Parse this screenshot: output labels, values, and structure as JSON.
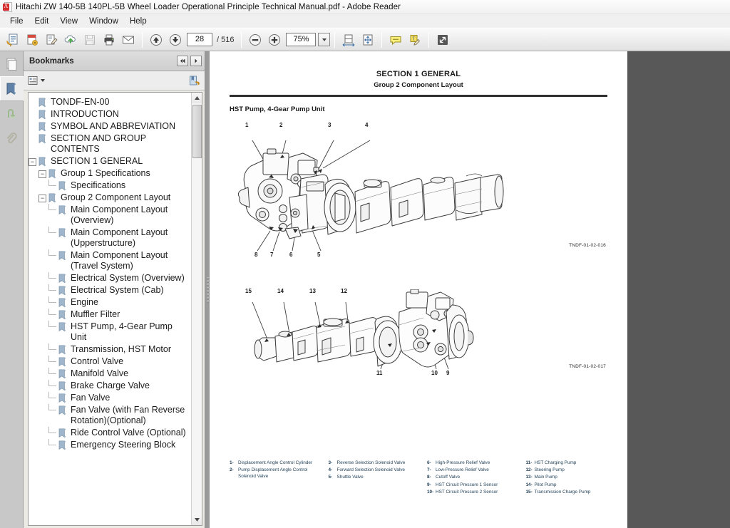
{
  "window": {
    "title": "Hitachi ZW 140-5B 140PL-5B Wheel Loader Operational Principle Technical Manual.pdf - Adobe Reader",
    "app_icon": "pdf-document-icon"
  },
  "menu": {
    "items": [
      "File",
      "Edit",
      "View",
      "Window",
      "Help"
    ]
  },
  "toolbar": {
    "buttons": [
      {
        "name": "open-file-icon",
        "label": "Open"
      },
      {
        "name": "create-pdf-icon",
        "label": "Create PDF"
      },
      {
        "name": "edit-pdf-icon",
        "label": "Edit PDF"
      },
      {
        "name": "cloud-upload-icon",
        "label": "Save to Cloud"
      },
      {
        "name": "save-disk-icon",
        "label": "Save"
      },
      {
        "name": "print-icon",
        "label": "Print"
      },
      {
        "name": "email-icon",
        "label": "Email"
      }
    ],
    "page_up_icon": "arrow-up-circle-icon",
    "page_down_icon": "arrow-down-circle-icon",
    "current_page": "28",
    "page_total": "/ 516",
    "zoom_out_icon": "minus-circle-icon",
    "zoom_in_icon": "plus-circle-icon",
    "zoom_value": "75%",
    "zoom_dropdown_icon": "chevron-down-icon",
    "fit_width_icon": "fit-width-icon",
    "fit_page_icon": "fit-page-icon",
    "comment_icon": "sticky-note-icon",
    "highlight_icon": "highlight-text-icon",
    "fullscreen_icon": "fullscreen-icon"
  },
  "rail": {
    "items": [
      {
        "name": "page-thumbnails-icon",
        "label": "Page Thumbnails",
        "selected": false
      },
      {
        "name": "bookmarks-icon",
        "label": "Bookmarks",
        "selected": true
      },
      {
        "name": "signatures-icon",
        "label": "Signatures",
        "selected": false
      },
      {
        "name": "attachments-icon",
        "label": "Attachments",
        "selected": false
      }
    ]
  },
  "bookmarks_panel": {
    "title": "Bookmarks",
    "prev_icon": "nav-prev-icon",
    "next_icon": "nav-next-icon",
    "options_icon": "bookmark-options-icon",
    "options_caret_icon": "caret-down-icon",
    "new_bookmark_icon": "new-bookmark-icon",
    "scroll_up_icon": "scroll-up-arrow",
    "scroll_down_icon": "scroll-down-arrow",
    "items": [
      {
        "label": "TONDF-EN-00",
        "indent": 0,
        "expander": ""
      },
      {
        "label": "INTRODUCTION",
        "indent": 0,
        "expander": ""
      },
      {
        "label": "SYMBOL AND ABBREVIATION",
        "indent": 0,
        "expander": ""
      },
      {
        "label": "SECTION AND GROUP CONTENTS",
        "indent": 0,
        "expander": ""
      },
      {
        "label": "SECTION 1 GENERAL",
        "indent": 0,
        "expander": "−"
      },
      {
        "label": "Group 1 Specifications",
        "indent": 1,
        "expander": "−"
      },
      {
        "label": "Specifications",
        "indent": 2,
        "expander": ""
      },
      {
        "label": "Group 2 Component Layout",
        "indent": 1,
        "expander": "−"
      },
      {
        "label": "Main Component Layout (Overview)",
        "indent": 2,
        "expander": ""
      },
      {
        "label": "Main Component Layout (Upperstructure)",
        "indent": 2,
        "expander": ""
      },
      {
        "label": "Main Component Layout (Travel System)",
        "indent": 2,
        "expander": ""
      },
      {
        "label": "Electrical System (Overview)",
        "indent": 2,
        "expander": ""
      },
      {
        "label": "Electrical System (Cab)",
        "indent": 2,
        "expander": ""
      },
      {
        "label": "Engine",
        "indent": 2,
        "expander": ""
      },
      {
        "label": "Muffler Filter",
        "indent": 2,
        "expander": ""
      },
      {
        "label": "HST Pump, 4-Gear Pump Unit",
        "indent": 2,
        "expander": ""
      },
      {
        "label": "Transmission, HST Motor",
        "indent": 2,
        "expander": ""
      },
      {
        "label": "Control Valve",
        "indent": 2,
        "expander": ""
      },
      {
        "label": "Manifold Valve",
        "indent": 2,
        "expander": ""
      },
      {
        "label": "Brake Charge Valve",
        "indent": 2,
        "expander": ""
      },
      {
        "label": "Fan Valve",
        "indent": 2,
        "expander": ""
      },
      {
        "label": "Fan Valve (with Fan Reverse Rotation)(Optional)",
        "indent": 2,
        "expander": ""
      },
      {
        "label": "Ride Control Valve (Optional)",
        "indent": 2,
        "expander": ""
      },
      {
        "label": "Emergency Steering Block",
        "indent": 2,
        "expander": ""
      }
    ]
  },
  "document": {
    "section_title": "SECTION 1 GENERAL",
    "group_title": "Group 2 Component Layout",
    "heading": "HST Pump, 4-Gear Pump Unit",
    "figure_1": {
      "code": "TNDF-01-02-016",
      "callouts": [
        "1",
        "2",
        "3",
        "4",
        "5",
        "6",
        "7",
        "8"
      ]
    },
    "figure_2": {
      "code": "TNDF-01-02-017",
      "callouts": [
        "9",
        "10",
        "11",
        "12",
        "13",
        "14",
        "15"
      ]
    },
    "legend_columns": [
      [
        {
          "num": "1-",
          "text": "Displacement Angle Control Cylinder"
        },
        {
          "num": "2-",
          "text": "Pump Displacement Angle Control Solenoid Valve"
        }
      ],
      [
        {
          "num": "3-",
          "text": "Reverse Selection Solenoid Valve"
        },
        {
          "num": "4-",
          "text": "Forward Selection Solenoid Valve"
        },
        {
          "num": "5-",
          "text": "Shuttle Valve"
        }
      ],
      [
        {
          "num": "6-",
          "text": "High-Pressure Relief Valve"
        },
        {
          "num": "7-",
          "text": "Low-Pressure Relief Valve"
        },
        {
          "num": "8-",
          "text": "Cutoff Valve"
        },
        {
          "num": "9-",
          "text": "HST Circuit Pressure 1 Sensor"
        },
        {
          "num": "10-",
          "text": "HST Circuit Pressure 2 Sensor"
        }
      ],
      [
        {
          "num": "11-",
          "text": "HST Charging Pump"
        },
        {
          "num": "12-",
          "text": "Steering Pump"
        },
        {
          "num": "13-",
          "text": "Main Pump"
        },
        {
          "num": "14-",
          "text": "Pilot Pump"
        },
        {
          "num": "15-",
          "text": "Transmission Charge Pump"
        }
      ]
    ]
  },
  "colors": {
    "title_bar": "#f4f4f4",
    "toolbar": "#ededed",
    "viewer_background": "#585858",
    "page": "#ffffff",
    "legend_text": "#24445c",
    "bookmark_icon": "#9fb6cc"
  }
}
